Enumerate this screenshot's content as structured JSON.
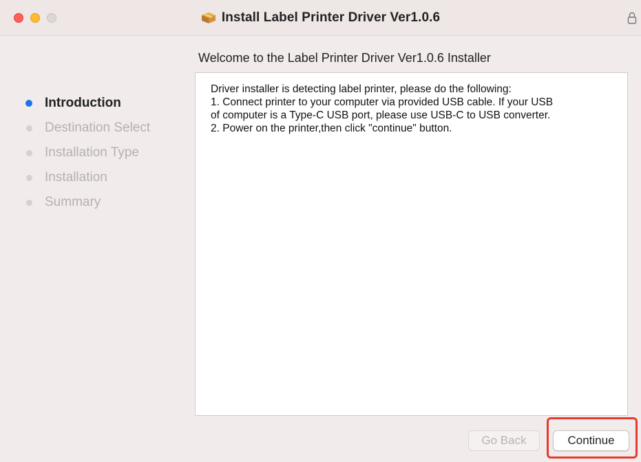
{
  "window": {
    "title": "Install Label Printer Driver Ver1.0.6",
    "icon": "package-box-icon",
    "lock_icon": "lock-icon"
  },
  "colors": {
    "active_step": "#1a73e8",
    "close": "#fe5f57",
    "minimize": "#febc2e",
    "highlight": "#e8392f"
  },
  "sidebar": {
    "steps": [
      {
        "label": "Introduction",
        "active": true
      },
      {
        "label": "Destination Select",
        "active": false
      },
      {
        "label": "Installation Type",
        "active": false
      },
      {
        "label": "Installation",
        "active": false
      },
      {
        "label": "Summary",
        "active": false
      }
    ]
  },
  "main": {
    "heading": "Welcome to the Label Printer Driver Ver1.0.6 Installer",
    "body_lines": [
      "Driver installer is detecting label printer, please do the following:",
      "1. Connect printer to your computer via provided USB cable. If your USB",
      "of computer is a Type-C USB port, please use USB-C to USB converter.",
      "2. Power on the printer,then click \"continue\" button."
    ]
  },
  "buttons": {
    "back_label": "Go Back",
    "continue_label": "Continue"
  }
}
